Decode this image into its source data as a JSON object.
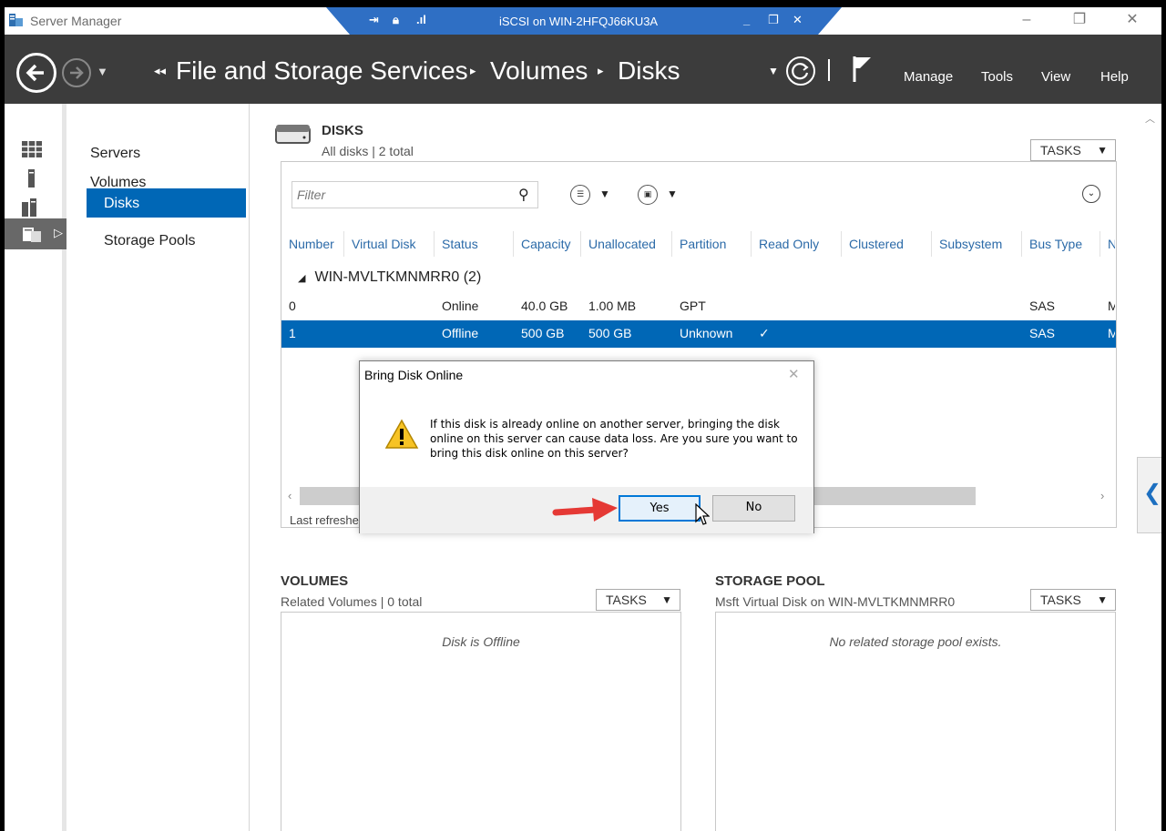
{
  "window": {
    "title": "Server Manager",
    "controls": [
      "minimize",
      "restore",
      "close"
    ]
  },
  "rdp_bar": {
    "title": "iSCSI on WIN-2HFQJ66KU3A"
  },
  "header": {
    "breadcrumb": [
      "File and Storage Services",
      "Volumes",
      "Disks"
    ],
    "menu": [
      "Manage",
      "Tools",
      "View",
      "Help"
    ]
  },
  "nav": {
    "items": [
      "Servers",
      "Volumes",
      "Disks",
      "Storage Pools"
    ],
    "selected": "Disks"
  },
  "disks": {
    "title": "DISKS",
    "subtitle": "All disks | 2 total",
    "tasks": "TASKS",
    "filter_placeholder": "Filter",
    "columns": [
      "Number",
      "Virtual Disk",
      "Status",
      "Capacity",
      "Unallocated",
      "Partition",
      "Read Only",
      "Clustered",
      "Subsystem",
      "Bus Type",
      "N"
    ],
    "group": "WIN-MVLTKMNMRR0 (2)",
    "rows": [
      {
        "number": "0",
        "virtual_disk": "",
        "status": "Online",
        "capacity": "40.0 GB",
        "unallocated": "1.00 MB",
        "partition": "GPT",
        "read_only": "",
        "bus_type": "SAS",
        "name": "M"
      },
      {
        "number": "1",
        "virtual_disk": "",
        "status": "Offline",
        "capacity": "500 GB",
        "unallocated": "500 GB",
        "partition": "Unknown",
        "read_only": "✓",
        "bus_type": "SAS",
        "name": "M"
      }
    ],
    "last_refreshed": "Last refreshe"
  },
  "volumes": {
    "title": "VOLUMES",
    "subtitle": "Related Volumes | 0 total",
    "tasks": "TASKS",
    "empty": "Disk is Offline"
  },
  "storage_pool": {
    "title": "STORAGE POOL",
    "subtitle": "Msft Virtual Disk on WIN-MVLTKMNMRR0",
    "tasks": "TASKS",
    "empty": "No related storage pool exists."
  },
  "dialog": {
    "title": "Bring Disk Online",
    "message": "If this disk is already online on another server, bringing the disk online on this server can cause data loss. Are you sure you want to bring this disk online on this server?",
    "yes": "Yes",
    "no": "No"
  },
  "colors": {
    "accent": "#0067b6",
    "header": "#3c3c3c",
    "arrow": "#e53935"
  }
}
